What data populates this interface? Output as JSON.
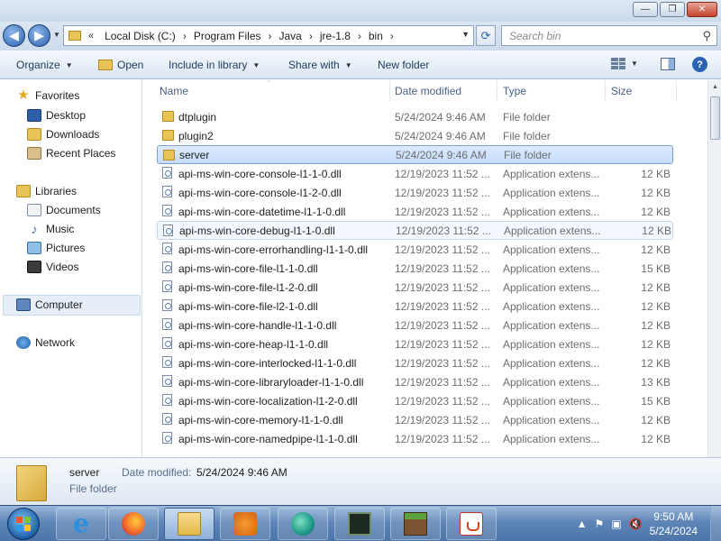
{
  "window": {
    "minimize_glyph": "—",
    "maximize_glyph": "❐",
    "close_glyph": "✕"
  },
  "address": {
    "lead_chevron": "«",
    "crumbs": [
      "Local Disk (C:)",
      "Program Files",
      "Java",
      "jre-1.8",
      "bin"
    ],
    "separator": "›",
    "dropdown_glyph": "▼",
    "refresh_glyph": "⟳",
    "back_glyph": "◀",
    "forward_glyph": "▶",
    "history_glyph": "▼"
  },
  "search": {
    "placeholder": "Search bin",
    "icon": "search-icon",
    "icon_glyph": "⚲"
  },
  "toolbar": {
    "organize": "Organize",
    "open": "Open",
    "include": "Include in library",
    "share": "Share with",
    "new_folder": "New folder",
    "dropdown_glyph": "▼",
    "help_glyph": "?"
  },
  "nav": {
    "favorites": "Favorites",
    "desktop": "Desktop",
    "downloads": "Downloads",
    "recent": "Recent Places",
    "libraries": "Libraries",
    "documents": "Documents",
    "music": "Music",
    "pictures": "Pictures",
    "videos": "Videos",
    "computer": "Computer",
    "network": "Network",
    "star_glyph": "★",
    "music_glyph": "♪"
  },
  "columns": {
    "name": "Name",
    "date": "Date modified",
    "type": "Type",
    "size": "Size",
    "sort_glyph": "^"
  },
  "files": [
    {
      "name": "dtplugin",
      "date": "5/24/2024 9:46 AM",
      "type": "File folder",
      "size": "",
      "kind": "folder"
    },
    {
      "name": "plugin2",
      "date": "5/24/2024 9:46 AM",
      "type": "File folder",
      "size": "",
      "kind": "folder"
    },
    {
      "name": "server",
      "date": "5/24/2024 9:46 AM",
      "type": "File folder",
      "size": "",
      "kind": "folder"
    },
    {
      "name": "api-ms-win-core-console-l1-1-0.dll",
      "date": "12/19/2023 11:52 ...",
      "type": "Application extens...",
      "size": "12 KB",
      "kind": "dll"
    },
    {
      "name": "api-ms-win-core-console-l1-2-0.dll",
      "date": "12/19/2023 11:52 ...",
      "type": "Application extens...",
      "size": "12 KB",
      "kind": "dll"
    },
    {
      "name": "api-ms-win-core-datetime-l1-1-0.dll",
      "date": "12/19/2023 11:52 ...",
      "type": "Application extens...",
      "size": "12 KB",
      "kind": "dll"
    },
    {
      "name": "api-ms-win-core-debug-l1-1-0.dll",
      "date": "12/19/2023 11:52 ...",
      "type": "Application extens...",
      "size": "12 KB",
      "kind": "dll"
    },
    {
      "name": "api-ms-win-core-errorhandling-l1-1-0.dll",
      "date": "12/19/2023 11:52 ...",
      "type": "Application extens...",
      "size": "12 KB",
      "kind": "dll"
    },
    {
      "name": "api-ms-win-core-file-l1-1-0.dll",
      "date": "12/19/2023 11:52 ...",
      "type": "Application extens...",
      "size": "15 KB",
      "kind": "dll"
    },
    {
      "name": "api-ms-win-core-file-l1-2-0.dll",
      "date": "12/19/2023 11:52 ...",
      "type": "Application extens...",
      "size": "12 KB",
      "kind": "dll"
    },
    {
      "name": "api-ms-win-core-file-l2-1-0.dll",
      "date": "12/19/2023 11:52 ...",
      "type": "Application extens...",
      "size": "12 KB",
      "kind": "dll"
    },
    {
      "name": "api-ms-win-core-handle-l1-1-0.dll",
      "date": "12/19/2023 11:52 ...",
      "type": "Application extens...",
      "size": "12 KB",
      "kind": "dll"
    },
    {
      "name": "api-ms-win-core-heap-l1-1-0.dll",
      "date": "12/19/2023 11:52 ...",
      "type": "Application extens...",
      "size": "12 KB",
      "kind": "dll"
    },
    {
      "name": "api-ms-win-core-interlocked-l1-1-0.dll",
      "date": "12/19/2023 11:52 ...",
      "type": "Application extens...",
      "size": "12 KB",
      "kind": "dll"
    },
    {
      "name": "api-ms-win-core-libraryloader-l1-1-0.dll",
      "date": "12/19/2023 11:52 ...",
      "type": "Application extens...",
      "size": "13 KB",
      "kind": "dll"
    },
    {
      "name": "api-ms-win-core-localization-l1-2-0.dll",
      "date": "12/19/2023 11:52 ...",
      "type": "Application extens...",
      "size": "15 KB",
      "kind": "dll"
    },
    {
      "name": "api-ms-win-core-memory-l1-1-0.dll",
      "date": "12/19/2023 11:52 ...",
      "type": "Application extens...",
      "size": "12 KB",
      "kind": "dll"
    },
    {
      "name": "api-ms-win-core-namedpipe-l1-1-0.dll",
      "date": "12/19/2023 11:52 ...",
      "type": "Application extens...",
      "size": "12 KB",
      "kind": "dll"
    }
  ],
  "selected_index": 2,
  "hover_index": 6,
  "details": {
    "name": "server",
    "date_label": "Date modified:",
    "date": "5/24/2024 9:46 AM",
    "type": "File folder"
  },
  "taskbar": {
    "apps": [
      "internet-explorer",
      "firefox",
      "windows-explorer",
      "media-player",
      "fish-app",
      "terminal",
      "minecraft",
      "java"
    ],
    "active_app": "windows-explorer",
    "ie_glyph": "e",
    "tray": {
      "show_hidden_glyph": "▲",
      "flag_glyph": "⚑",
      "network_glyph": "▣",
      "volume_glyph": "🔇"
    },
    "time": "9:50 AM",
    "date": "5/24/2024"
  }
}
